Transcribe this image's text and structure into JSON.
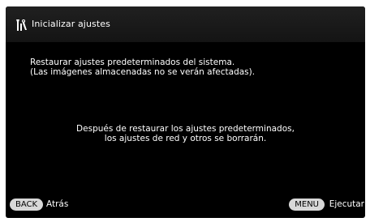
{
  "header": {
    "icon": "wrench-tools-icon",
    "title": "Inicializar ajustes"
  },
  "main": {
    "description_line1": "Restaurar ajustes predeterminados del sistema.",
    "description_line2": "(Las imágenes almacenadas no se verán afectadas).",
    "warning_line1": "Después de restaurar los ajustes predeterminados,",
    "warning_line2": "los ajustes de red y otros se borrarán."
  },
  "footer": {
    "back_button": "BACK",
    "back_label": "Atrás",
    "menu_button": "MENU",
    "execute_label": "Ejecutar"
  },
  "colors": {
    "background": "#000000",
    "text": "#ffffff",
    "button_bg": "#d8d8d8",
    "button_text": "#000000"
  }
}
